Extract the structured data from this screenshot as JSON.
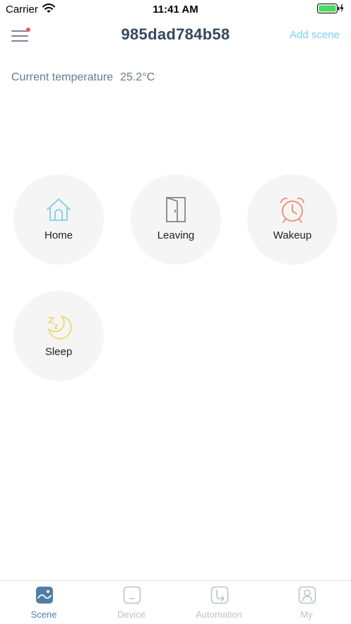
{
  "status_bar": {
    "carrier": "Carrier",
    "time": "11:41 AM"
  },
  "nav": {
    "title": "985dad784b58",
    "add_scene": "Add scene"
  },
  "temperature": {
    "label": "Current temperature",
    "value": "25.2°C"
  },
  "scenes": [
    {
      "label": "Home",
      "icon": "home-icon",
      "color": "#7dcff0"
    },
    {
      "label": "Leaving",
      "icon": "door-icon",
      "color": "#7a7a7a"
    },
    {
      "label": "Wakeup",
      "icon": "alarm-clock-icon",
      "color": "#f28b6a"
    },
    {
      "label": "Sleep",
      "icon": "moon-icon",
      "color": "#e8d778"
    }
  ],
  "tabs": [
    {
      "label": "Scene",
      "icon": "scene-icon",
      "active": true
    },
    {
      "label": "Device",
      "icon": "device-icon",
      "active": false
    },
    {
      "label": "Automation",
      "icon": "automation-icon",
      "active": false
    },
    {
      "label": "My",
      "icon": "user-icon",
      "active": false
    }
  ],
  "colors": {
    "accent": "#7dcff0",
    "tab_active": "#4f7fa8",
    "tab_inactive": "#b9c3cc",
    "title": "#34495e",
    "notification_dot": "#f05a5a"
  }
}
